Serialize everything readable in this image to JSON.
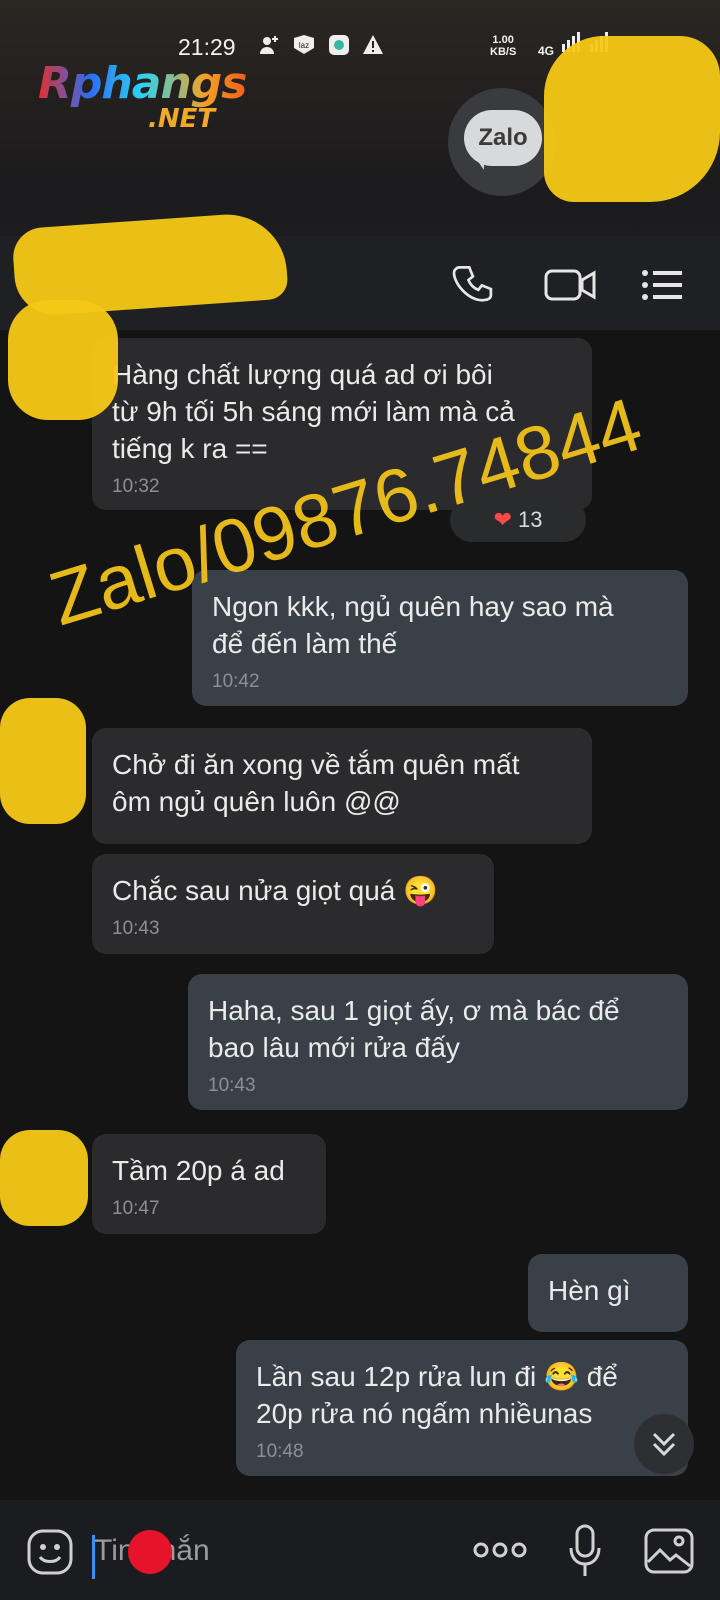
{
  "status_bar": {
    "time": "21:29",
    "left_icons": [
      "person-add-icon",
      "laz-icon",
      "app-icon",
      "warning-icon"
    ],
    "net_speed": "1.00",
    "net_speed_unit": "KB/S",
    "network": "4G"
  },
  "branding": {
    "logo_name": "Rphangs",
    "logo_tld": ".NET",
    "app_badge": "Zalo"
  },
  "toolbar": {
    "icons": [
      "phone-call-icon",
      "video-call-icon",
      "menu-list-icon"
    ]
  },
  "reaction": {
    "count": "13",
    "heart": "❤"
  },
  "watermark": "Zalo/09876.74844",
  "messages": [
    {
      "direction": "in",
      "text": "Hàng chất lượng quá ad ơi bôi\ntừ 9h tối 5h sáng mới làm mà cả\ntiếng k ra ==",
      "time": "10:32"
    },
    {
      "direction": "out",
      "text": "Ngon kkk, ngủ quên hay sao mà\nđể đến làm thế",
      "time": "10:42"
    },
    {
      "direction": "in",
      "text": "Chở đi ăn xong về tắm quên mất\nôm ngủ quên luôn @@",
      "time": ""
    },
    {
      "direction": "in",
      "text": "Chắc sau nửa giọt quá 😜",
      "time": "10:43"
    },
    {
      "direction": "out",
      "text": "Haha, sau 1 giọt ấy, ơ mà bác để\nbao lâu mới rửa đấy",
      "time": "10:43"
    },
    {
      "direction": "in",
      "text": "Tầm 20p á ad",
      "time": "10:47"
    },
    {
      "direction": "out",
      "text": "Hèn gì",
      "time": ""
    },
    {
      "direction": "out",
      "text": "Lần sau 12p rửa lun đi 😂 để\n20p rửa nó ngấm nhiềunas",
      "time": "10:48"
    }
  ],
  "input": {
    "placeholder": "Tin nhắn",
    "icons": [
      "emoji-icon",
      "more-icon",
      "microphone-icon",
      "image-icon"
    ]
  },
  "colors": {
    "background": "#141414",
    "incoming_bubble": "#2b2b2d",
    "outgoing_bubble": "#3a4047",
    "watermark": "#f2c21b",
    "redaction": "#f6c816",
    "cursor": "#3a8ff2"
  }
}
